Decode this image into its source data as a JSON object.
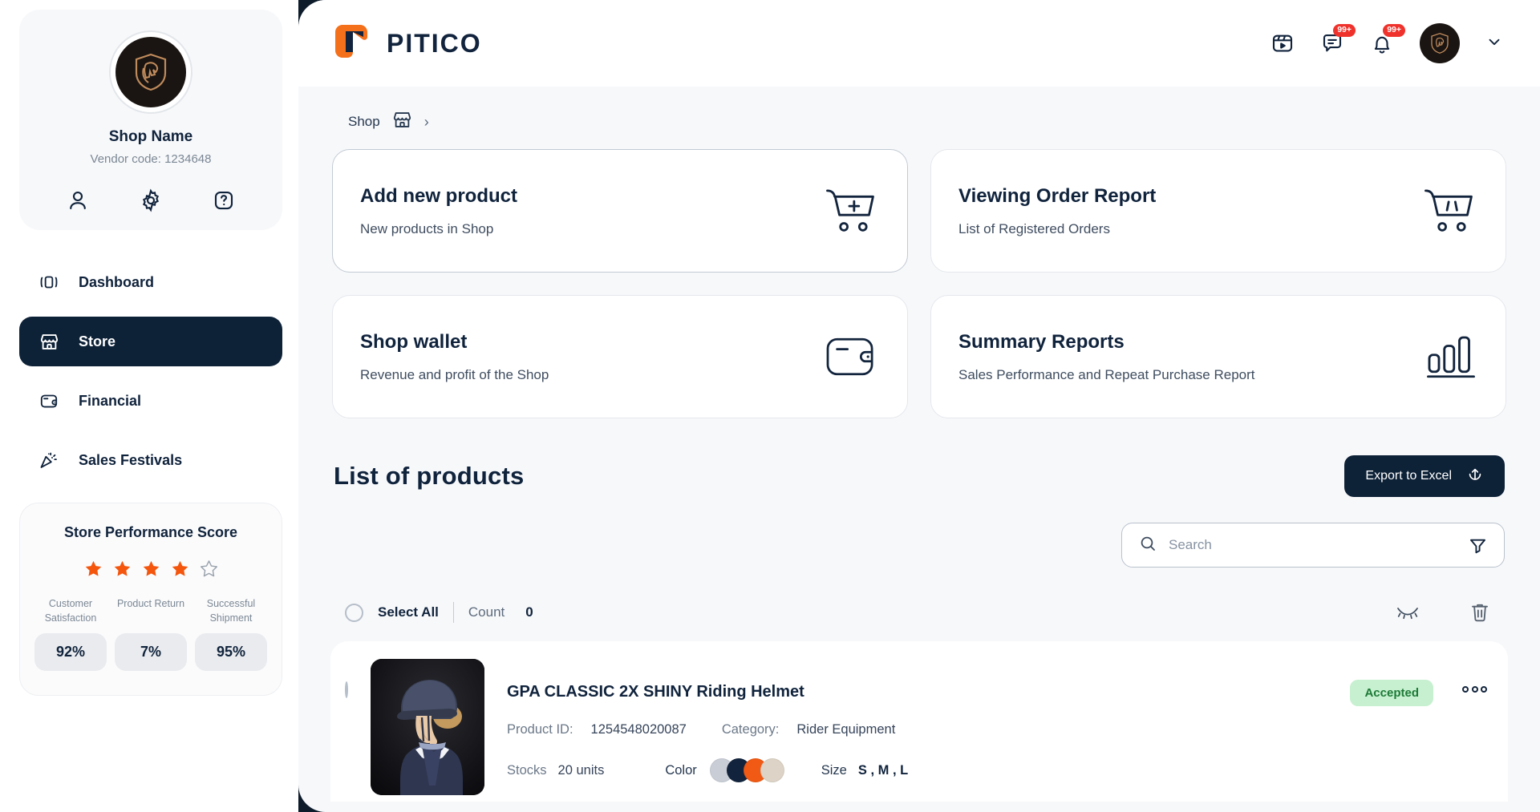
{
  "colors": {
    "accent_orange": "#f05a14",
    "dark_navy": "#0d2137",
    "brand_text": "#12243d",
    "badge_red": "#f0322c",
    "status_green_bg": "#c6f0cf",
    "status_green_text": "#1d7a37"
  },
  "sidebar": {
    "profile": {
      "avatar_icon": "horse-shield-logo",
      "shop_name": "Shop Name",
      "vendor_code": "Vendor code: 1234648",
      "actions": [
        {
          "name": "user-icon",
          "label": "Profile"
        },
        {
          "name": "gear-icon",
          "label": "Settings"
        },
        {
          "name": "help-icon",
          "label": "Help"
        }
      ]
    },
    "nav": [
      {
        "label": "Dashboard",
        "icon": "dashboard-icon",
        "active": false
      },
      {
        "label": "Store",
        "icon": "store-icon",
        "active": true
      },
      {
        "label": "Financial",
        "icon": "wallet-icon",
        "active": false
      },
      {
        "label": "Sales Festivals",
        "icon": "confetti-icon",
        "active": false
      }
    ],
    "performance": {
      "title": "Store Performance Score",
      "stars_filled": 4,
      "stars_total": 5,
      "metrics": [
        {
          "label": "Customer Satisfaction",
          "value": "92%"
        },
        {
          "label": "Product Return",
          "value": "7%"
        },
        {
          "label": "Successful Shipment",
          "value": "95%"
        }
      ]
    }
  },
  "topbar": {
    "brand": "PITICO",
    "logo_icon": "pitico-logo-icon",
    "actions": [
      {
        "name": "media-play-icon",
        "badge": ""
      },
      {
        "name": "chat-icon",
        "badge": "99+"
      },
      {
        "name": "bell-icon",
        "badge": "99+"
      }
    ],
    "avatar_icon": "horse-shield-logo",
    "chevron_icon": "chevron-down-icon"
  },
  "breadcrumb": {
    "label": "Shop",
    "icon": "store-icon",
    "separator": "›"
  },
  "action_cards": [
    {
      "title": "Add new product",
      "subtitle": "New products in Shop",
      "icon": "cart-plus-icon",
      "highlight": true
    },
    {
      "title": "Viewing Order Report",
      "subtitle": "List of Registered Orders",
      "icon": "cart-lines-icon",
      "highlight": false
    },
    {
      "title": "Shop wallet",
      "subtitle": "Revenue and profit of the Shop",
      "icon": "wallet-icon",
      "highlight": false
    },
    {
      "title": "Summary Reports",
      "subtitle": "Sales Performance and Repeat Purchase Report",
      "icon": "bar-chart-icon",
      "highlight": false
    }
  ],
  "products_section": {
    "title": "List of products",
    "export_label": "Export to Excel",
    "export_icon": "upload-icon",
    "search": {
      "placeholder": "Search",
      "value": "",
      "search_icon": "search-icon",
      "filter_icon": "filter-icon"
    },
    "toolbar": {
      "select_all_label": "Select All",
      "count_label": "Count",
      "count_value": "0",
      "hide_icon": "eye-closed-icon",
      "delete_icon": "trash-icon"
    },
    "products": [
      {
        "title": "GPA CLASSIC 2X SHINY Riding Helmet",
        "product_id_label": "Product ID:",
        "product_id": "1254548020087",
        "category_label": "Category:",
        "category": "Rider Equipment",
        "stocks_label": "Stocks",
        "stocks": "20 units",
        "color_label": "Color",
        "colors": [
          "#c9ced6",
          "#12243d",
          "#f05a14",
          "#ddd3c6"
        ],
        "size_label": "Size",
        "sizes": "S , M , L",
        "status": "Accepted",
        "more_icon": "more-options-icon",
        "thumbnail": "riding-helmet-photo"
      }
    ]
  }
}
